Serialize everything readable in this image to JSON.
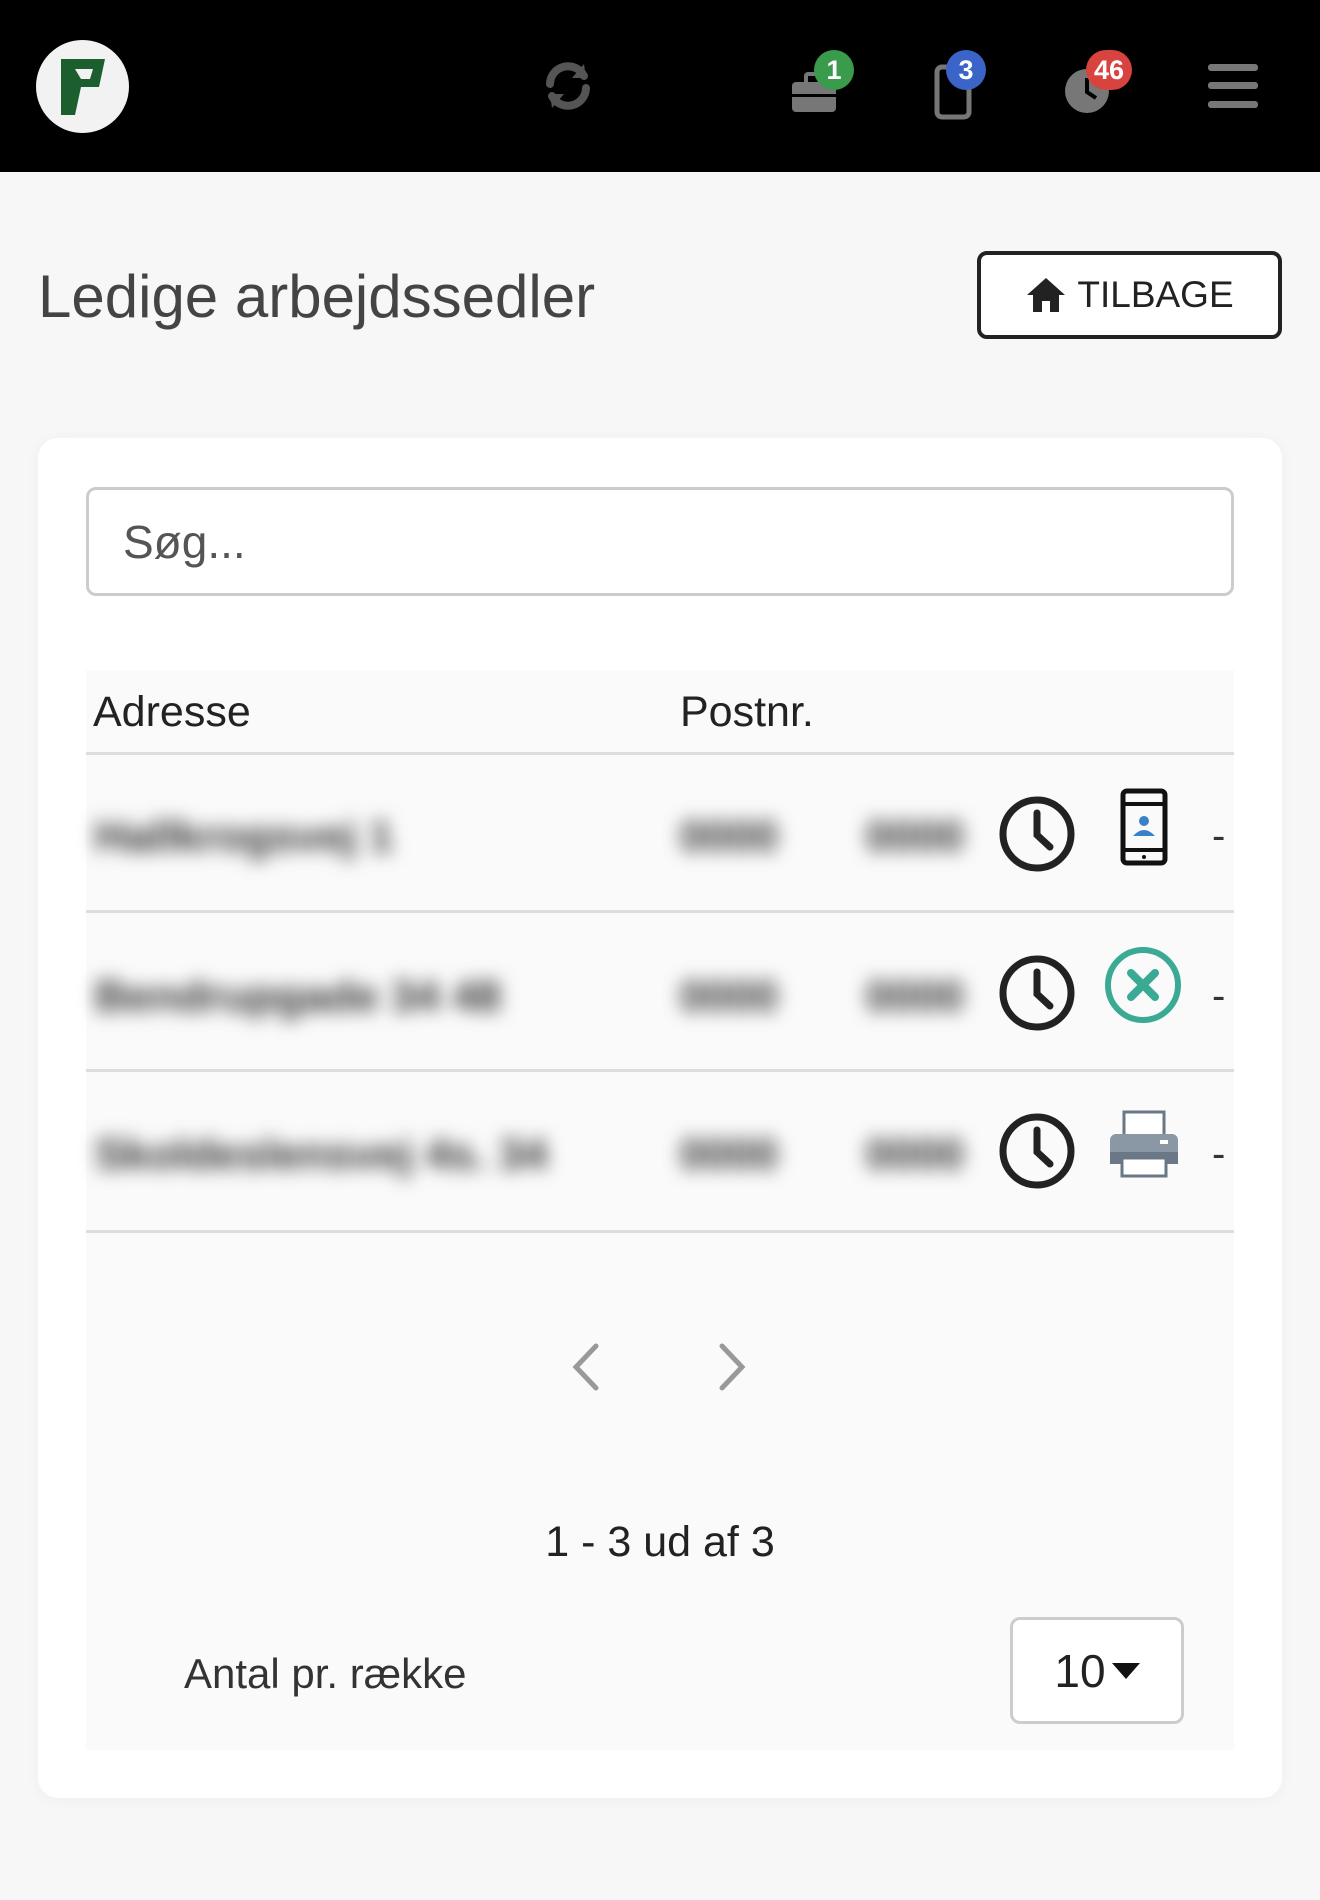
{
  "header": {
    "badges": {
      "jobs": "1",
      "phone": "3",
      "time": "46"
    },
    "colors": {
      "jobs_badge": "#3a9b4d",
      "phone_badge": "#3b64c8",
      "time_badge": "#d9433f"
    },
    "icons": [
      "logo-icon",
      "refresh-icon",
      "briefcase-icon",
      "phone-icon",
      "clock-icon",
      "menu-icon"
    ]
  },
  "page": {
    "title": "Ledige arbejdssedler",
    "back_button": "TILBAGE"
  },
  "search": {
    "placeholder": "Søg..."
  },
  "table": {
    "columns": {
      "address": "Adresse",
      "postal": "Postnr."
    },
    "rows": [
      {
        "address": "Hallkrogsvej 1",
        "postal": "0000",
        "extra": "0000",
        "status_icon": "mobile-profile-icon",
        "dash": "-"
      },
      {
        "address": "Bendrupgade 34 48",
        "postal": "0000",
        "extra": "0000",
        "status_icon": "cancel-circle-icon",
        "dash": "-"
      },
      {
        "address": "Skoldeslensvej 4s. 34",
        "postal": "0000",
        "extra": "0000",
        "status_icon": "printer-icon",
        "dash": "-"
      }
    ]
  },
  "pagination": {
    "summary": "1 - 3 ud af 3",
    "per_page_label": "Antal pr. række",
    "per_page_value": "10"
  }
}
